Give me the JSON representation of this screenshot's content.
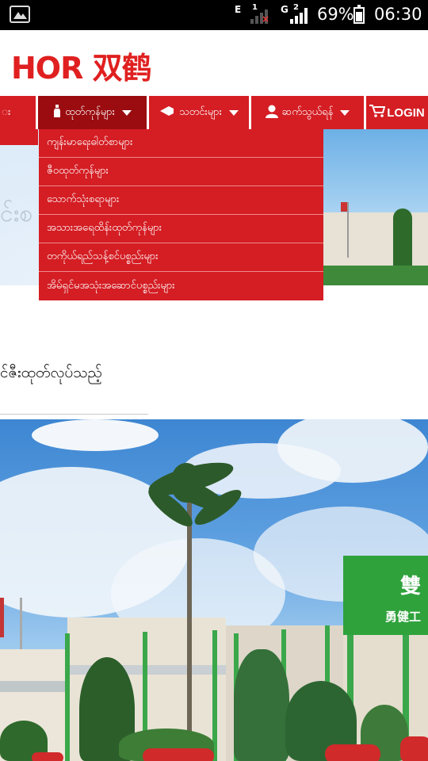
{
  "status_bar": {
    "network_1": "E",
    "sim_1": "1",
    "network_2": "G",
    "sim_2": "2",
    "battery": "69%",
    "time": "06:30"
  },
  "header": {
    "logo_text": "HOR 双鹤"
  },
  "nav": {
    "items": [
      {
        "label": "း"
      },
      {
        "label": "ထုတ်ကုန်များ"
      },
      {
        "label": "သတင်းများ"
      },
      {
        "label": "ဆက်သွယ်ရန်"
      },
      {
        "label": "LOGIN"
      }
    ]
  },
  "dropdown": {
    "items": [
      "ကျန်းမာရေးဓါတ်စာများ",
      "ဇီဝထုတ်ကုန်များ",
      "သောက်သုံးစရာများ",
      "အသားအရေထိန်းထုတ်ကုန်များ",
      "တကိုယ်ရည်သန့်စင်ပစ္စည်းများ",
      "အိမ်ရှင်မအသုံးအဆောင်ပစ္စည်းများ"
    ]
  },
  "hero": {
    "text": "င်းစ"
  },
  "content": {
    "heading": "င်ဇီးထုတ်လုပ်သည့်"
  },
  "photo": {
    "sign_main": "雙",
    "sign_sub": "勇健工"
  },
  "colors": {
    "brand_red": "#d41e24",
    "active_red": "#9a0c10",
    "factory_green": "#2fa23c"
  },
  "icons": [
    "gallery-icon",
    "signal-icon",
    "battery-icon",
    "bottle-icon",
    "megaphone-icon",
    "person-icon",
    "cart-icon",
    "caret-down-icon"
  ]
}
